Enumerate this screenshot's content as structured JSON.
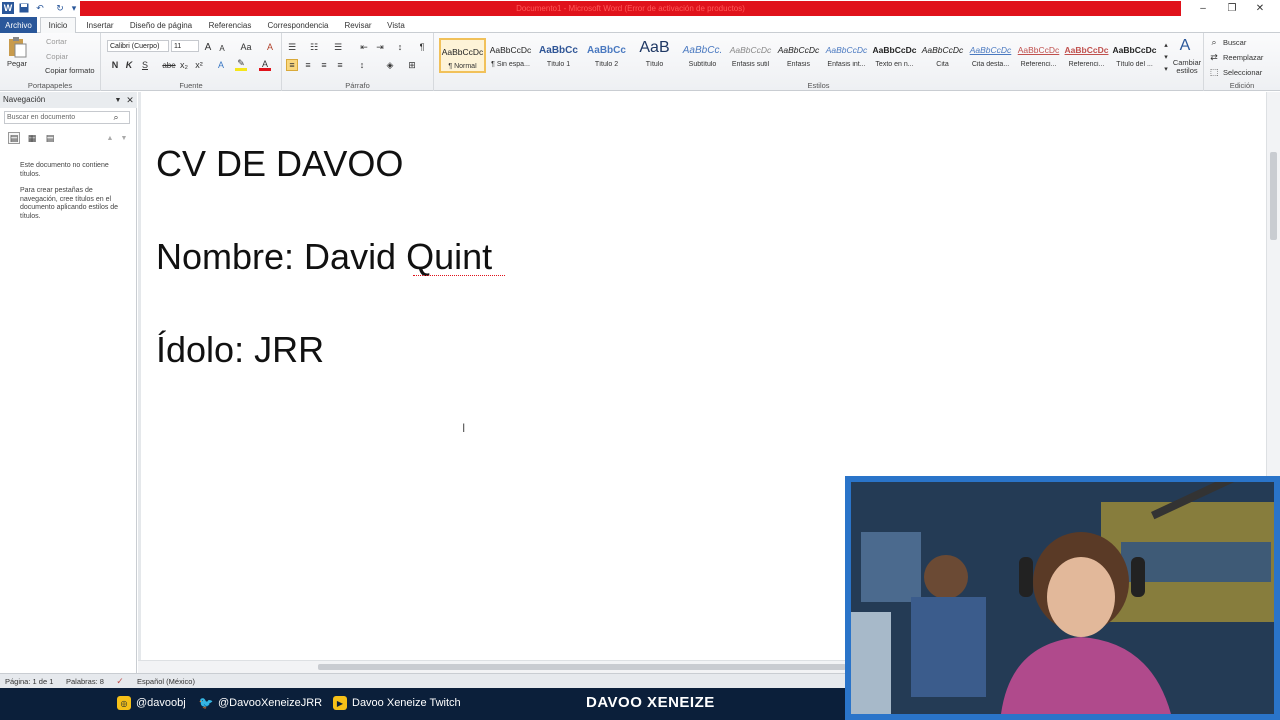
{
  "window": {
    "title": "Documento1 - Microsoft Word (Error de activación de productos)",
    "minimize": "–",
    "restore": "❐",
    "close": "✕"
  },
  "qat": {
    "word_icon": "W",
    "save_icon": "💾",
    "undo_icon": "↶",
    "redo_icon": "↻",
    "customize_icon": "▾"
  },
  "tabs": [
    "Archivo",
    "Inicio",
    "Insertar",
    "Diseño de página",
    "Referencias",
    "Correspondencia",
    "Revisar",
    "Vista"
  ],
  "ribbon": {
    "clipboard": {
      "paste": "Pegar",
      "cut": "Cortar",
      "copy": "Copiar",
      "format_painter": "Copiar formato",
      "label": "Portapapeles"
    },
    "font": {
      "font_name": "Calibri (Cuerpo)",
      "font_size": "11",
      "label": "Fuente",
      "bold": "N",
      "italic": "K",
      "underline": "S",
      "strike": "abe",
      "sub": "x₂",
      "sup": "x²",
      "grow": "A",
      "shrink": "A",
      "case": "Aa",
      "clear": "A"
    },
    "paragraph": {
      "label": "Párrafo",
      "pilcrow": "¶"
    },
    "styles": {
      "label": "Estilos",
      "items": [
        {
          "sample": "AaBbCcDc",
          "name": "¶ Normal"
        },
        {
          "sample": "AaBbCcDc",
          "name": "¶ Sin espa..."
        },
        {
          "sample": "AaBbCc",
          "name": "Título 1"
        },
        {
          "sample": "AaBbCc",
          "name": "Título 2"
        },
        {
          "sample": "AaB",
          "name": "Título"
        },
        {
          "sample": "AaBbCc.",
          "name": "Subtítulo"
        },
        {
          "sample": "AaBbCcDc",
          "name": "Énfasis sutil"
        },
        {
          "sample": "AaBbCcDc",
          "name": "Énfasis"
        },
        {
          "sample": "AaBbCcDc",
          "name": "Énfasis int..."
        },
        {
          "sample": "AaBbCcDc",
          "name": "Texto en n..."
        },
        {
          "sample": "AaBbCcDc",
          "name": "Cita"
        },
        {
          "sample": "AaBbCcDc",
          "name": "Cita desta..."
        },
        {
          "sample": "AaBbCcDc",
          "name": "Referenci..."
        },
        {
          "sample": "AaBbCcDc",
          "name": "Referenci..."
        },
        {
          "sample": "AaBbCcDc",
          "name": "Título del ..."
        }
      ],
      "change_styles": "Cambiar estilos"
    },
    "editing": {
      "find": "Buscar",
      "replace": "Reemplazar",
      "select": "Seleccionar",
      "label": "Edición"
    }
  },
  "nav": {
    "title": "Navegación",
    "search_placeholder": "Buscar en documento",
    "message_1": "Este documento no contiene títulos.",
    "message_2": "Para crear pestañas de navegación, cree títulos en el documento aplicando estilos de títulos."
  },
  "document": {
    "lines": [
      "CV DE DAVOO",
      "Nombre: David Quint",
      "Ídolo: JRR"
    ]
  },
  "status": {
    "page": "Página: 1 de 1",
    "words": "Palabras: 8",
    "language": "Español (México)"
  },
  "overlay": {
    "instagram": "@davoobj",
    "twitter": "@DavooXeneizeJRR",
    "twitch": "Davoo Xeneize Twitch",
    "streamer": "DAVOO XENEIZE"
  }
}
